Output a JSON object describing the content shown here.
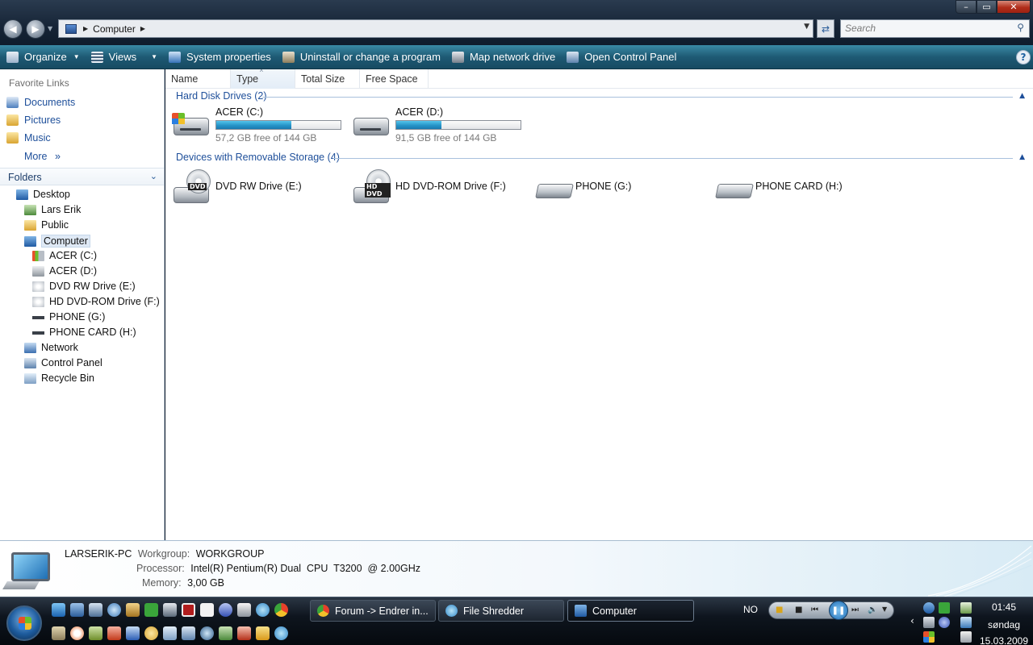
{
  "window": {
    "address_crumb": "Computer",
    "search_placeholder": "Search",
    "controls": {
      "minimize": "–",
      "maximize": "▭",
      "close": "✕"
    }
  },
  "toolbar": {
    "organize": "Organize",
    "views": "Views",
    "system_properties": "System properties",
    "uninstall": "Uninstall or change a program",
    "map_drive": "Map network drive",
    "control_panel": "Open Control Panel",
    "help": "?"
  },
  "nav": {
    "favorites_header": "Favorite Links",
    "favorites": [
      {
        "label": "Documents",
        "icon": "documents-icon"
      },
      {
        "label": "Pictures",
        "icon": "folder-icon"
      },
      {
        "label": "Music",
        "icon": "folder-icon"
      }
    ],
    "more": "More",
    "folders_header": "Folders",
    "tree": [
      {
        "label": "Desktop",
        "icon": "desktop-icon"
      },
      {
        "label": "Lars Erik",
        "icon": "user-folder-icon"
      },
      {
        "label": "Public",
        "icon": "folder-icon"
      },
      {
        "label": "Computer",
        "icon": "computer-icon",
        "selected": true
      },
      {
        "label": "ACER (C:)",
        "icon": "system-drive-icon"
      },
      {
        "label": "ACER (D:)",
        "icon": "hard-drive-icon"
      },
      {
        "label": "DVD RW Drive (E:)",
        "icon": "dvd-drive-icon"
      },
      {
        "label": "HD DVD-ROM Drive (F:)",
        "icon": "hd-dvd-drive-icon"
      },
      {
        "label": "PHONE (G:)",
        "icon": "removable-drive-icon"
      },
      {
        "label": "PHONE CARD (H:)",
        "icon": "removable-drive-icon"
      },
      {
        "label": "Network",
        "icon": "network-icon"
      },
      {
        "label": "Control Panel",
        "icon": "control-panel-icon"
      },
      {
        "label": "Recycle Bin",
        "icon": "recycle-bin-icon"
      }
    ]
  },
  "columns": {
    "name": "Name",
    "type": "Type",
    "total_size": "Total Size",
    "free_space": "Free Space"
  },
  "groups": {
    "hard_disks": {
      "title": "Hard Disk Drives (2)",
      "drives": [
        {
          "name": "ACER (C:)",
          "free_text": "57,2 GB free of 144 GB",
          "used_fraction": 0.603
        },
        {
          "name": "ACER (D:)",
          "free_text": "91,5 GB free of 144 GB",
          "used_fraction": 0.365
        }
      ]
    },
    "removable": {
      "title": "Devices with Removable Storage (4)",
      "drives": [
        {
          "name": "DVD RW Drive (E:)",
          "disc_label": "DVD"
        },
        {
          "name": "HD DVD-ROM Drive (F:)",
          "disc_label": "HD DVD"
        },
        {
          "name": "PHONE (G:)"
        },
        {
          "name": "PHONE CARD (H:)"
        }
      ]
    }
  },
  "details": {
    "computer_name": "LARSERIK-PC",
    "workgroup_label": "Workgroup:",
    "workgroup": "WORKGROUP",
    "processor_label": "Processor:",
    "processor": "Intel(R) Pentium(R) Dual  CPU  T3200  @ 2.00GHz",
    "memory_label": "Memory:",
    "memory": "3,00 GB"
  },
  "taskbar": {
    "buttons": [
      {
        "label": "Forum -> Endrer in...",
        "active": false
      },
      {
        "label": "File Shredder",
        "active": false
      },
      {
        "label": "Computer",
        "active": true
      }
    ],
    "language": "NO",
    "clock_time": "01:45",
    "clock_day": "søndag",
    "clock_date": "15.03.2009"
  },
  "colors": {
    "accent": "#1e4f9a",
    "progress": "#2794c8",
    "toolbar": "#1e5a74"
  }
}
